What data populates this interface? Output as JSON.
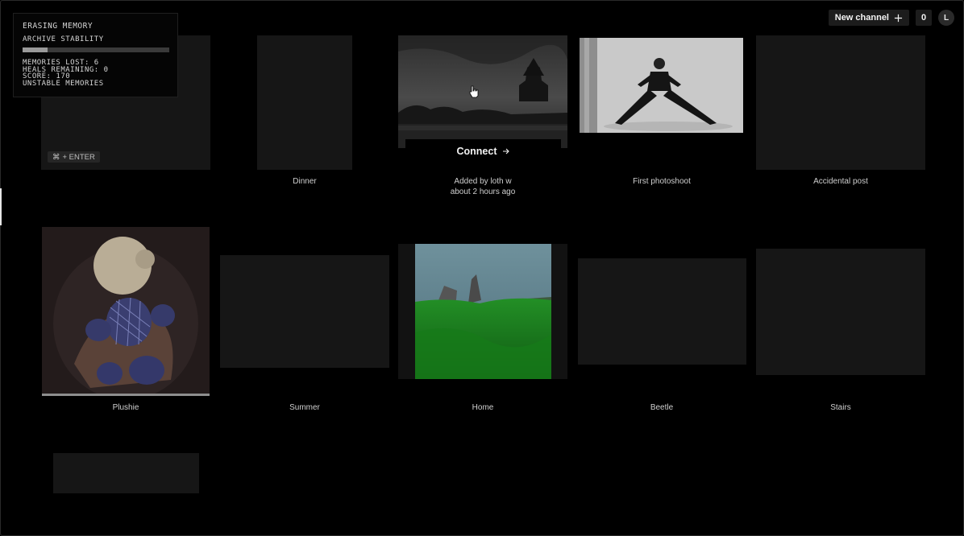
{
  "header": {
    "new_channel_label": "New channel",
    "count": "0",
    "avatar_initial": "L"
  },
  "hud": {
    "title": "ERASING MEMORY",
    "stability_label": "ARCHIVE STABILITY",
    "stability_fraction": 0.17,
    "memories_lost": "MEMORIES LOST: 6",
    "heals_remaining": "HEALS REMAINING: 0",
    "score": "SCORE: 170",
    "unstable": "UNSTABLE MEMORIES"
  },
  "hint": {
    "key_icon": "command-icon",
    "text": "+ ENTER"
  },
  "connect": {
    "label": "Connect",
    "arrow_icon": "arrow-right-icon",
    "added_by": "Added by loth w",
    "time": "about 2 hours ago"
  },
  "captions": {
    "dinner": "Dinner",
    "first_photoshoot": "First photoshoot",
    "accidental_post": "Accidental post",
    "plushie": "Plushie",
    "summer": "Summer",
    "home": "Home",
    "beetle": "Beetle",
    "stairs": "Stairs"
  },
  "colors": {
    "background": "#000000",
    "block": "#161616",
    "home_sky": "#5b7a86",
    "home_grass": "#1f8f22"
  }
}
